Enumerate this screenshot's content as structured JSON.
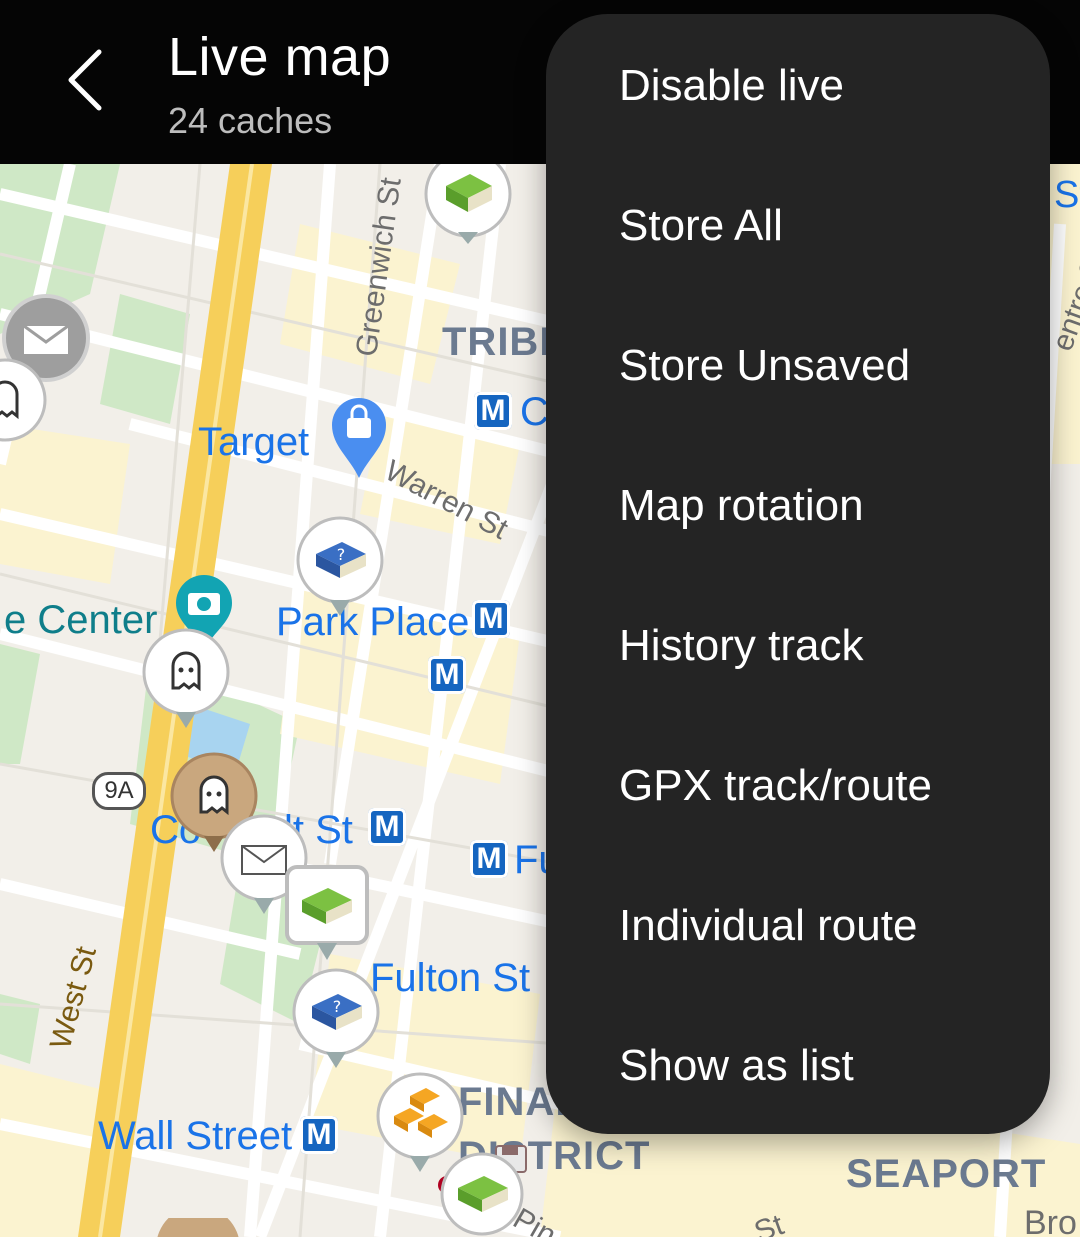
{
  "header": {
    "title": "Live map",
    "subtitle": "24 caches",
    "back_icon": "chevron-left-icon"
  },
  "menu": {
    "items": [
      {
        "label": "Disable live"
      },
      {
        "label": "Store All"
      },
      {
        "label": "Store Unsaved"
      },
      {
        "label": "Map rotation"
      },
      {
        "label": "History track"
      },
      {
        "label": "GPX track/route"
      },
      {
        "label": "Individual route"
      },
      {
        "label": "Show as list"
      }
    ]
  },
  "map": {
    "labels": {
      "target": "Target",
      "center": "e Center",
      "park_place": "Park Place",
      "wall_street": "Wall Street",
      "fulton_st": "Fulton St",
      "fu": "Fu",
      "c": "C",
      "co": "Co",
      "lt_st": "lt St",
      "tribeca": "TRIBI",
      "financial_1": "FINAN",
      "financial_2": "DISTRICT",
      "seaport": "SEAPORT",
      "greenwich": "Greenwich St",
      "warren": "Warren St",
      "west_st": "West St",
      "route_9a": "9A",
      "pin": "Pin",
      "st_edge": "St",
      "bro": "Bro",
      "centre": "entre S",
      "st_bottom": "St",
      "metro_letter": "M"
    },
    "colors": {
      "map_background": "#f2efe9",
      "road": "#ffffff",
      "highway": "#f8d66d",
      "park": "#c8e6c9",
      "metro": "#1565c0",
      "menu_background": "#242424"
    }
  }
}
